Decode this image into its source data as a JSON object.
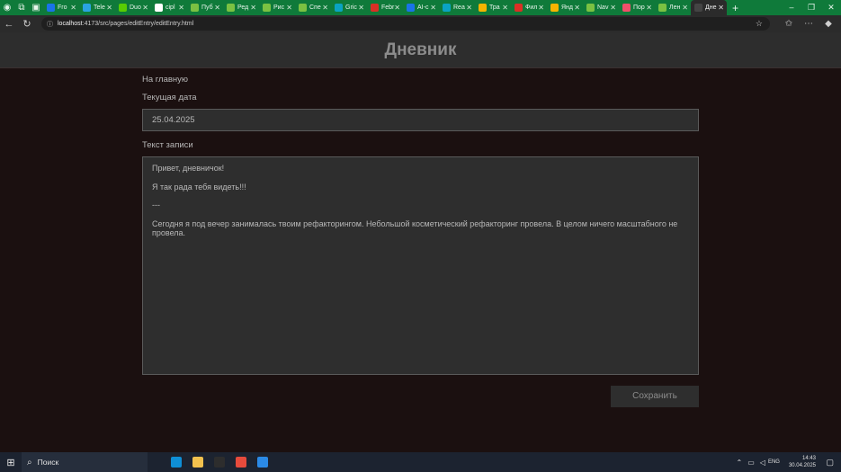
{
  "browser": {
    "tabs": [
      {
        "label": "Fro",
        "color": "#1a73e8"
      },
      {
        "label": "Tele",
        "color": "#2aa3e0"
      },
      {
        "label": "Duo",
        "color": "#58cc02"
      },
      {
        "label": "cipl",
        "color": "#ffffff"
      },
      {
        "label": "Пуб",
        "color": "#7bc142"
      },
      {
        "label": "Ред",
        "color": "#7bc142"
      },
      {
        "label": "Рис",
        "color": "#7bc142"
      },
      {
        "label": "Спе",
        "color": "#7bc142"
      },
      {
        "label": "Gric",
        "color": "#0aa3c2"
      },
      {
        "label": "Febr",
        "color": "#d93025"
      },
      {
        "label": "AI-c",
        "color": "#1a73e8"
      },
      {
        "label": "Rea",
        "color": "#0aa3c2"
      },
      {
        "label": "Тра",
        "color": "#f5b400"
      },
      {
        "label": "Фил",
        "color": "#d93025"
      },
      {
        "label": "Янд",
        "color": "#f5b400"
      },
      {
        "label": "Nav",
        "color": "#7bc142"
      },
      {
        "label": "Пор",
        "color": "#f04f6a"
      },
      {
        "label": "Лен",
        "color": "#7bc142"
      },
      {
        "label": "Дне",
        "color": "#444444",
        "active": true
      }
    ],
    "new_tab_glyph": "+",
    "url_host": "localhost",
    "url_path": ":4173/src/pages/editEntry/editEntry.html"
  },
  "page": {
    "title": "Дневник",
    "home_link": "На главную",
    "date_label": "Текущая дата",
    "date_value": "25.04.2025",
    "text_label": "Текст записи",
    "entry_lines": [
      "Привет, дневничок!",
      "Я так рада тебя видеть!!!",
      "---",
      "Сегодня я под вечер занималась твоим рефакторингом. Небольшой косметический рефакторинг провела. В целом ничего масштабного не провела."
    ],
    "save_button": "Сохранить"
  },
  "taskbar": {
    "search_placeholder": "Поиск",
    "language": "ENG",
    "time": "14:43",
    "date": "30.04.2025",
    "apps": [
      {
        "name": "edge",
        "color": "#0f8fd6"
      },
      {
        "name": "file-explorer",
        "color": "#f2c14e"
      },
      {
        "name": "terminal",
        "color": "#2d2d2d"
      },
      {
        "name": "figma",
        "color": "#e64b3c"
      },
      {
        "name": "vscode",
        "color": "#2b8ae6"
      }
    ]
  }
}
